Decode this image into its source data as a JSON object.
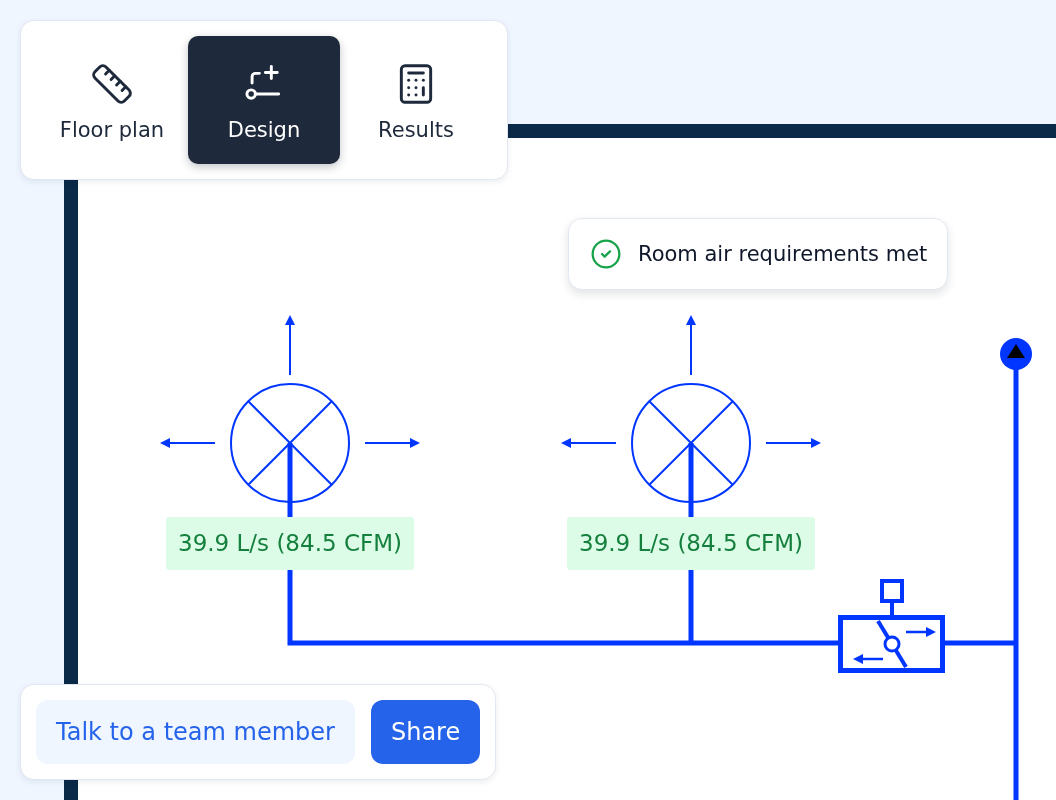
{
  "toolbar": {
    "tabs": [
      {
        "label": "Floor plan",
        "selected": false
      },
      {
        "label": "Design",
        "selected": true
      },
      {
        "label": "Results",
        "selected": false
      }
    ]
  },
  "status": {
    "kind": "success",
    "text": "Room air requirements met"
  },
  "diffusers": [
    {
      "flow": "39.9 L/s (84.5 CFM)"
    },
    {
      "flow": "39.9 L/s (84.5 CFM)"
    }
  ],
  "actions": {
    "buttons": [
      {
        "label": "Talk to a team member",
        "kind": "secondary"
      },
      {
        "label": "Share",
        "kind": "primary"
      }
    ]
  }
}
